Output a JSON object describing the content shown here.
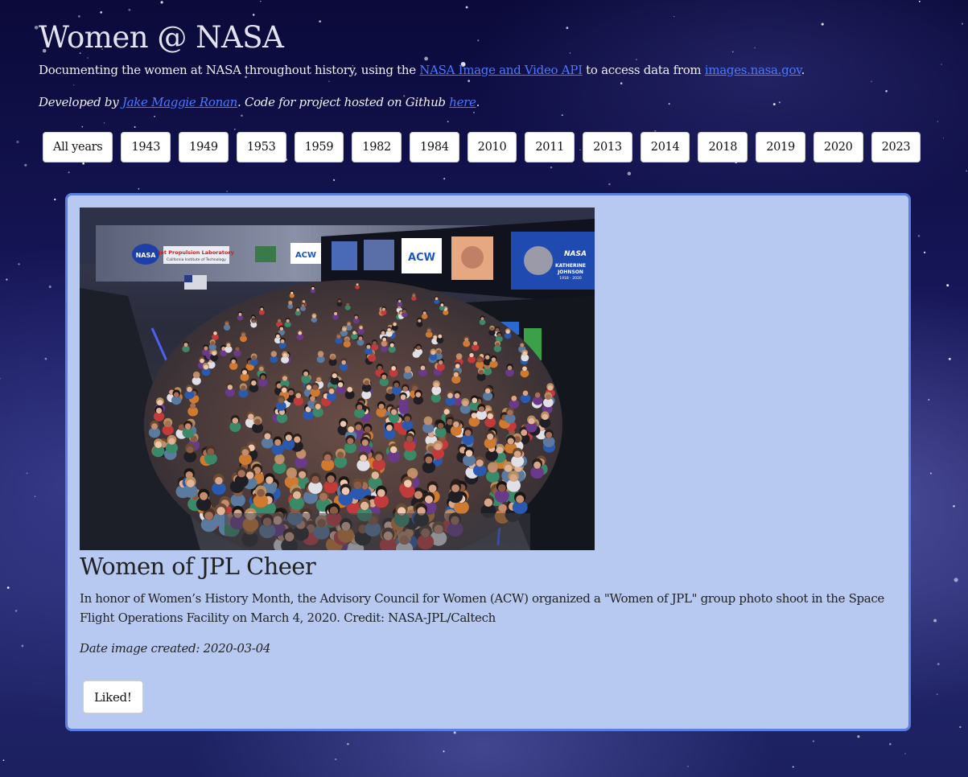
{
  "header": {
    "title": "Women @ NASA",
    "intro_before": "Documenting the women at NASA throughout history, using the ",
    "api_link": "NASA Image and Video API",
    "intro_middle": " to access data from ",
    "site_link": "images.nasa.gov",
    "intro_after": ".",
    "credits_before": "Developed by ",
    "author_link": "Jake Maggie Ronan",
    "credits_middle": ". Code for project hosted on Github ",
    "github_link": "here",
    "credits_after": "."
  },
  "year_filters": [
    "All years",
    "1943",
    "1949",
    "1953",
    "1959",
    "1982",
    "1984",
    "2010",
    "2011",
    "2013",
    "2014",
    "2018",
    "2019",
    "2020",
    "2023"
  ],
  "item": {
    "title": "Women of JPL Cheer",
    "description": "In honor of Women’s History Month, the Advisory Council for Women (ACW) organized a \"Women of JPL\" group photo shoot in the Space Flight Operations Facility on March 4, 2020. Credit: NASA-JPL/Caltech",
    "date_label": "Date image created: ",
    "date_value": "2020-03-04",
    "like_label": "Liked!",
    "photo_signage": {
      "lab_name": "Jet Propulsion Laboratory",
      "lab_sub": "California Institute of Technology",
      "nasa": "NASA",
      "acw": "ACW",
      "katherine": "KATHERINE",
      "johnson": "JOHNSON",
      "years": "1918 - 2020"
    }
  },
  "colors": {
    "link": "#4a78ff",
    "card_background": "#b7c9f1",
    "card_border": "#5a7fe0",
    "page_background": "#17175a"
  }
}
